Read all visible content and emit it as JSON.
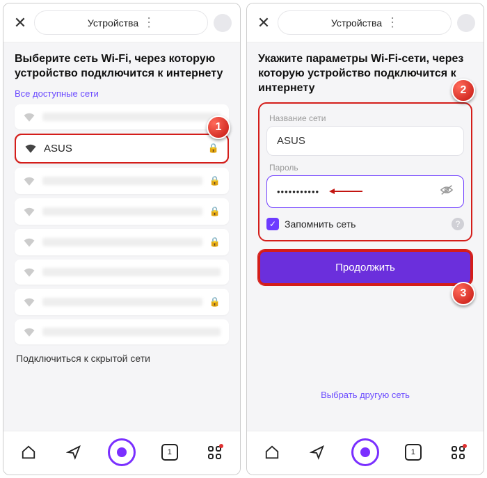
{
  "header": {
    "title": "Устройства"
  },
  "left": {
    "heading": "Выберите сеть Wi-Fi, через которую устройство подключится к интернету",
    "all_networks": "Все доступные сети",
    "selected_ssid": "ASUS",
    "hidden_net": "Подключиться к скрытой сети",
    "badge": "1"
  },
  "right": {
    "heading": "Укажите параметры Wi-Fi-сети, через которую устройство подключится к интернету",
    "ssid_label": "Название сети",
    "ssid_value": "ASUS",
    "pw_label": "Пароль",
    "pw_value": "•••••••••••",
    "remember": "Запомнить сеть",
    "continue": "Продолжить",
    "other_net": "Выбрать другую сеть",
    "badge_form": "2",
    "badge_btn": "3"
  },
  "nav": {
    "tab_count": "1"
  }
}
